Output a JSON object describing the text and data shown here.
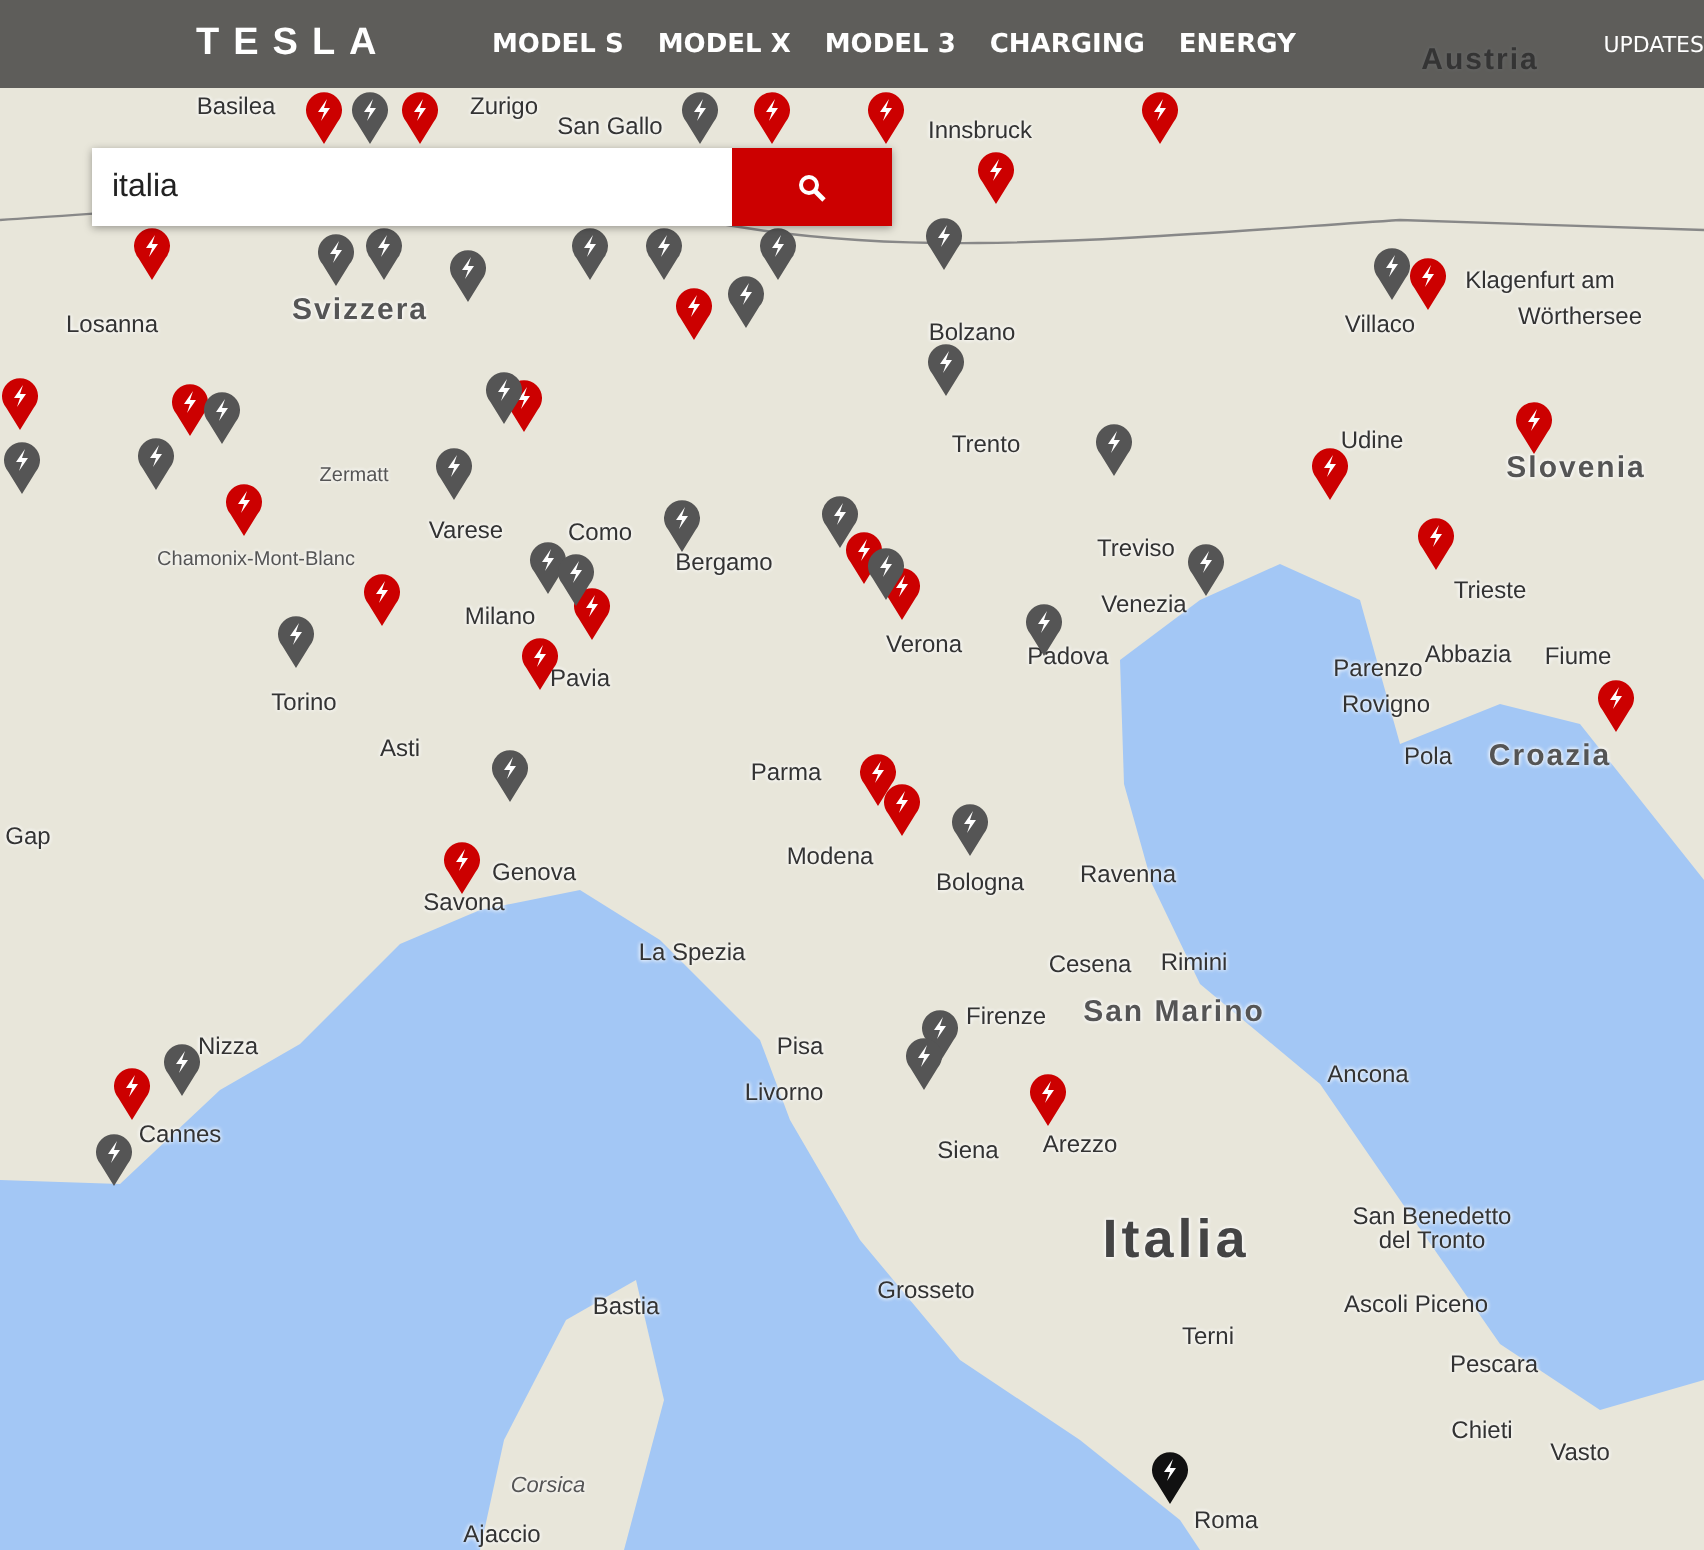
{
  "nav": {
    "logo": "TESLA",
    "items": [
      {
        "label": "MODEL S"
      },
      {
        "label": "MODEL X"
      },
      {
        "label": "MODEL 3"
      },
      {
        "label": "CHARGING"
      },
      {
        "label": "ENERGY"
      }
    ],
    "right_link": "UPDATES"
  },
  "search": {
    "value": "italia"
  },
  "map_labels": [
    {
      "text": "Austria",
      "kind": "country"
    },
    {
      "text": "Svizzera",
      "kind": "country"
    },
    {
      "text": "Slovenia",
      "kind": "country"
    },
    {
      "text": "Croazia",
      "kind": "country"
    },
    {
      "text": "San Marino",
      "kind": "country"
    },
    {
      "text": "Italia",
      "kind": "major"
    },
    {
      "text": "Innsbruck",
      "kind": "city"
    },
    {
      "text": "San Gallo",
      "kind": "city"
    },
    {
      "text": "Basilea",
      "kind": "city"
    },
    {
      "text": "Zurigo",
      "kind": "city"
    },
    {
      "text": "Losanna",
      "kind": "city"
    },
    {
      "text": "Bolzano",
      "kind": "city"
    },
    {
      "text": "Trento",
      "kind": "city"
    },
    {
      "text": "Villaco",
      "kind": "city"
    },
    {
      "text": "Udine",
      "kind": "city"
    },
    {
      "text": "Klagenfurt am",
      "kind": "city"
    },
    {
      "text": "Wörthersee",
      "kind": "city"
    },
    {
      "text": "Zermatt",
      "kind": "small"
    },
    {
      "text": "Chamonix-Mont-Blanc",
      "kind": "small"
    },
    {
      "text": "Varese",
      "kind": "city"
    },
    {
      "text": "Como",
      "kind": "city"
    },
    {
      "text": "Bergamo",
      "kind": "city"
    },
    {
      "text": "Milano",
      "kind": "city"
    },
    {
      "text": "Pavia",
      "kind": "city"
    },
    {
      "text": "Verona",
      "kind": "city"
    },
    {
      "text": "Treviso",
      "kind": "city"
    },
    {
      "text": "Venezia",
      "kind": "city"
    },
    {
      "text": "Padova",
      "kind": "city"
    },
    {
      "text": "Trieste",
      "kind": "city"
    },
    {
      "text": "Parenzo",
      "kind": "city"
    },
    {
      "text": "Abbazia",
      "kind": "city"
    },
    {
      "text": "Fiume",
      "kind": "city"
    },
    {
      "text": "Rovigno",
      "kind": "city"
    },
    {
      "text": "Pola",
      "kind": "city"
    },
    {
      "text": "Torino",
      "kind": "city"
    },
    {
      "text": "Asti",
      "kind": "city"
    },
    {
      "text": "Parma",
      "kind": "city"
    },
    {
      "text": "Modena",
      "kind": "city"
    },
    {
      "text": "Genova",
      "kind": "city"
    },
    {
      "text": "Bologna",
      "kind": "city"
    },
    {
      "text": "Ravenna",
      "kind": "city"
    },
    {
      "text": "Savona",
      "kind": "city"
    },
    {
      "text": "La Spezia",
      "kind": "city"
    },
    {
      "text": "Cesena",
      "kind": "city"
    },
    {
      "text": "Rimini",
      "kind": "city"
    },
    {
      "text": "Pisa",
      "kind": "city"
    },
    {
      "text": "Livorno",
      "kind": "city"
    },
    {
      "text": "Firenze",
      "kind": "city"
    },
    {
      "text": "Siena",
      "kind": "city"
    },
    {
      "text": "Arezzo",
      "kind": "city"
    },
    {
      "text": "Ancona",
      "kind": "city"
    },
    {
      "text": "Nizza",
      "kind": "city"
    },
    {
      "text": "Cannes",
      "kind": "city"
    },
    {
      "text": "San Benedetto",
      "kind": "city"
    },
    {
      "text": "del Tronto",
      "kind": "city"
    },
    {
      "text": "Grosseto",
      "kind": "city"
    },
    {
      "text": "Bastia",
      "kind": "city"
    },
    {
      "text": "Terni",
      "kind": "city"
    },
    {
      "text": "Ascoli Piceno",
      "kind": "city"
    },
    {
      "text": "Pescara",
      "kind": "city"
    },
    {
      "text": "Chieti",
      "kind": "city"
    },
    {
      "text": "Vasto",
      "kind": "city"
    },
    {
      "text": "Corsica",
      "kind": "region"
    },
    {
      "text": "Ajaccio",
      "kind": "city"
    },
    {
      "text": "Roma",
      "kind": "city"
    },
    {
      "text": "Gap",
      "kind": "city"
    }
  ],
  "pins": [
    {
      "color": "#cc0000"
    },
    {
      "color": "#cc0000"
    },
    {
      "color": "#cc0000"
    },
    {
      "color": "#cc0000"
    },
    {
      "color": "#cc0000"
    },
    {
      "color": "#cc0000"
    },
    {
      "color": "#cc0000"
    },
    {
      "color": "#cc0000"
    },
    {
      "color": "#cc0000"
    },
    {
      "color": "#cc0000"
    },
    {
      "color": "#cc0000"
    },
    {
      "color": "#cc0000"
    },
    {
      "color": "#cc0000"
    },
    {
      "color": "#cc0000"
    },
    {
      "color": "#cc0000"
    },
    {
      "color": "#cc0000"
    },
    {
      "color": "#cc0000"
    },
    {
      "color": "#cc0000"
    },
    {
      "color": "#cc0000"
    },
    {
      "color": "#cc0000"
    },
    {
      "color": "#cc0000"
    },
    {
      "color": "#cc0000"
    },
    {
      "color": "#cc0000"
    },
    {
      "color": "#cc0000"
    },
    {
      "color": "#cc0000"
    },
    {
      "color": "#cc0000"
    },
    {
      "color": "#cc0000"
    },
    {
      "color": "#555555"
    },
    {
      "color": "#555555"
    },
    {
      "color": "#555555"
    },
    {
      "color": "#555555"
    },
    {
      "color": "#555555"
    },
    {
      "color": "#555555"
    },
    {
      "color": "#555555"
    },
    {
      "color": "#555555"
    },
    {
      "color": "#555555"
    },
    {
      "color": "#555555"
    },
    {
      "color": "#555555"
    },
    {
      "color": "#555555"
    },
    {
      "color": "#555555"
    },
    {
      "color": "#555555"
    },
    {
      "color": "#555555"
    },
    {
      "color": "#555555"
    },
    {
      "color": "#555555"
    },
    {
      "color": "#555555"
    },
    {
      "color": "#555555"
    },
    {
      "color": "#555555"
    },
    {
      "color": "#555555"
    },
    {
      "color": "#555555"
    },
    {
      "color": "#555555"
    },
    {
      "color": "#555555"
    },
    {
      "color": "#555555"
    },
    {
      "color": "#555555"
    },
    {
      "color": "#555555"
    },
    {
      "color": "#555555"
    },
    {
      "color": "#555555"
    },
    {
      "color": "#555555"
    },
    {
      "color": "#555555"
    },
    {
      "color": "#555555"
    },
    {
      "color": "#111111"
    }
  ]
}
